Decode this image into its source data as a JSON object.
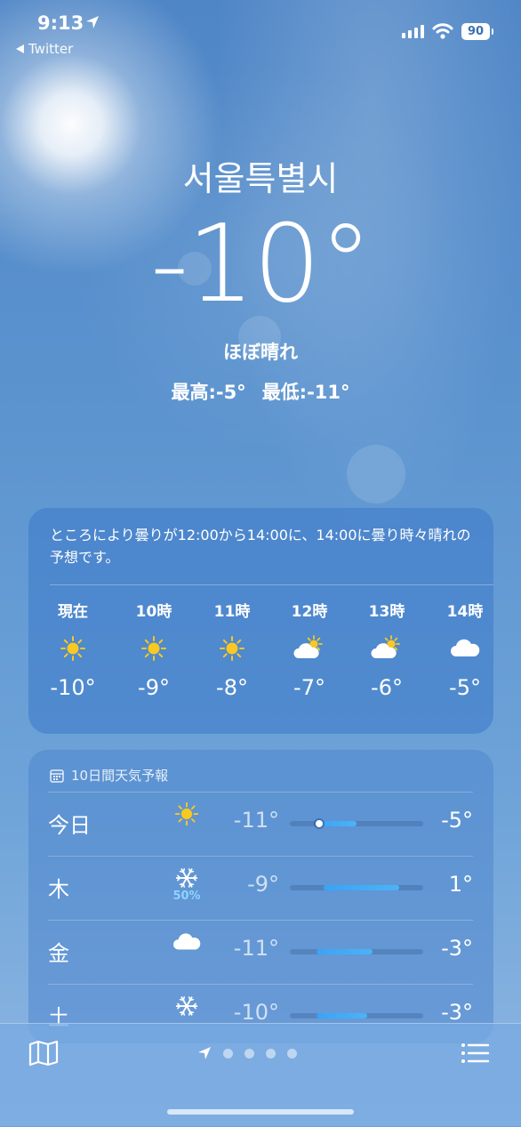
{
  "status_bar": {
    "time": "9:13",
    "back_label": "Twitter",
    "battery": "90"
  },
  "current": {
    "city": "서울특별시",
    "temperature": "-10°",
    "condition": "ほぼ晴れ",
    "high": "最高:-5°",
    "low": "最低:-11°"
  },
  "hourly": {
    "summary": "ところにより曇りが12:00から14:00に、14:00に曇り時々晴れの予想です。",
    "items": [
      {
        "label": "現在",
        "icon": "sun-icon",
        "temp": "-10°"
      },
      {
        "label": "10時",
        "icon": "sun-icon",
        "temp": "-9°"
      },
      {
        "label": "11時",
        "icon": "sun-icon",
        "temp": "-8°"
      },
      {
        "label": "12時",
        "icon": "partly-cloudy-icon",
        "temp": "-7°"
      },
      {
        "label": "13時",
        "icon": "partly-cloudy-icon",
        "temp": "-6°"
      },
      {
        "label": "14時",
        "icon": "cloud-icon",
        "temp": "-5°"
      }
    ]
  },
  "daily": {
    "title": "10日間天気予報",
    "rows": [
      {
        "day": "今日",
        "icon": "sun-icon",
        "precip": "",
        "low": "-11°",
        "high": "-5°",
        "range": [
          0.2,
          0.5
        ],
        "current_marker": 0.22
      },
      {
        "day": "木",
        "icon": "snowflake-icon",
        "precip": "50%",
        "low": "-9°",
        "high": "1°",
        "range": [
          0.25,
          0.82
        ]
      },
      {
        "day": "金",
        "icon": "cloud-icon",
        "precip": "",
        "low": "-11°",
        "high": "-3°",
        "range": [
          0.2,
          0.62
        ]
      },
      {
        "day": "土",
        "icon": "snowflake-icon",
        "precip": "",
        "low": "-10°",
        "high": "-3°",
        "range": [
          0.2,
          0.58
        ]
      }
    ]
  },
  "pager": {
    "count": 5,
    "active": 0
  },
  "colors": {
    "sun": "#f9c822",
    "bar": "#3aa3f5",
    "precip": "#8fd3ff"
  }
}
